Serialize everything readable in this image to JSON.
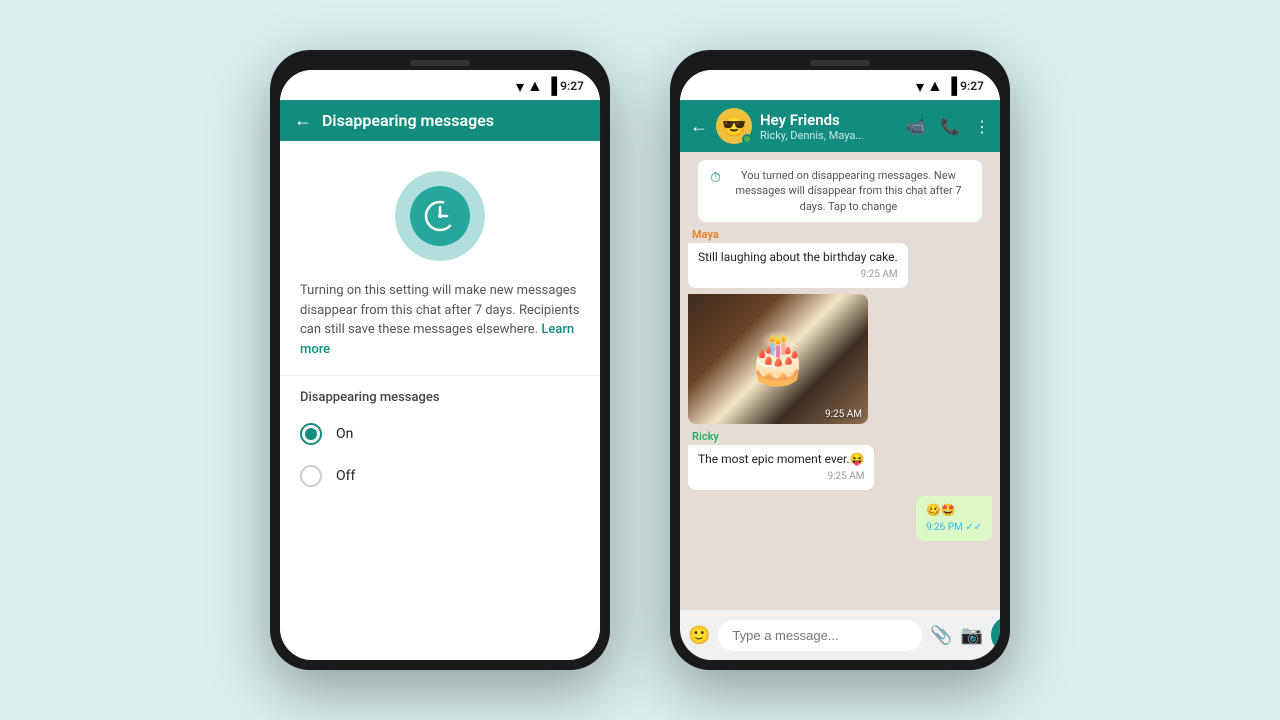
{
  "scene": {
    "background_color": "#d8f0ee"
  },
  "phone1": {
    "status_bar": {
      "time": "9:27"
    },
    "header": {
      "title": "Disappearing messages",
      "back_label": "←"
    },
    "description": "Turning on this setting will make new messages disappear from this chat after 7 days. Recipients can still save these messages elsewhere.",
    "learn_more": "Learn more",
    "section_title": "Disappearing messages",
    "options": [
      {
        "label": "On",
        "selected": true
      },
      {
        "label": "Off",
        "selected": false
      }
    ]
  },
  "phone2": {
    "status_bar": {
      "time": "9:27"
    },
    "header": {
      "chat_name": "Hey Friends",
      "chat_sub": "Ricky, Dennis, Maya...",
      "avatar_emoji": "😎",
      "back_label": "←"
    },
    "system_message": "You turned on disappearing messages. New messages will disappear from this chat after 7 days. Tap to change",
    "messages": [
      {
        "type": "received",
        "sender": "Maya",
        "sender_color": "maya",
        "text": "Still laughing about the birthday cake.",
        "time": "9:25 AM",
        "has_image": false
      },
      {
        "type": "received",
        "sender": "Maya",
        "sender_color": "maya",
        "text": "",
        "time": "9:25 AM",
        "has_image": true
      },
      {
        "type": "received",
        "sender": "Ricky",
        "sender_color": "ricky",
        "text": "The most epic moment ever.😝",
        "time": "9:25 AM",
        "has_image": false
      },
      {
        "type": "sent",
        "text": "🥴🤩",
        "time": "9:26 PM ✓✓",
        "has_image": false
      }
    ],
    "input_placeholder": "Type a message..."
  }
}
